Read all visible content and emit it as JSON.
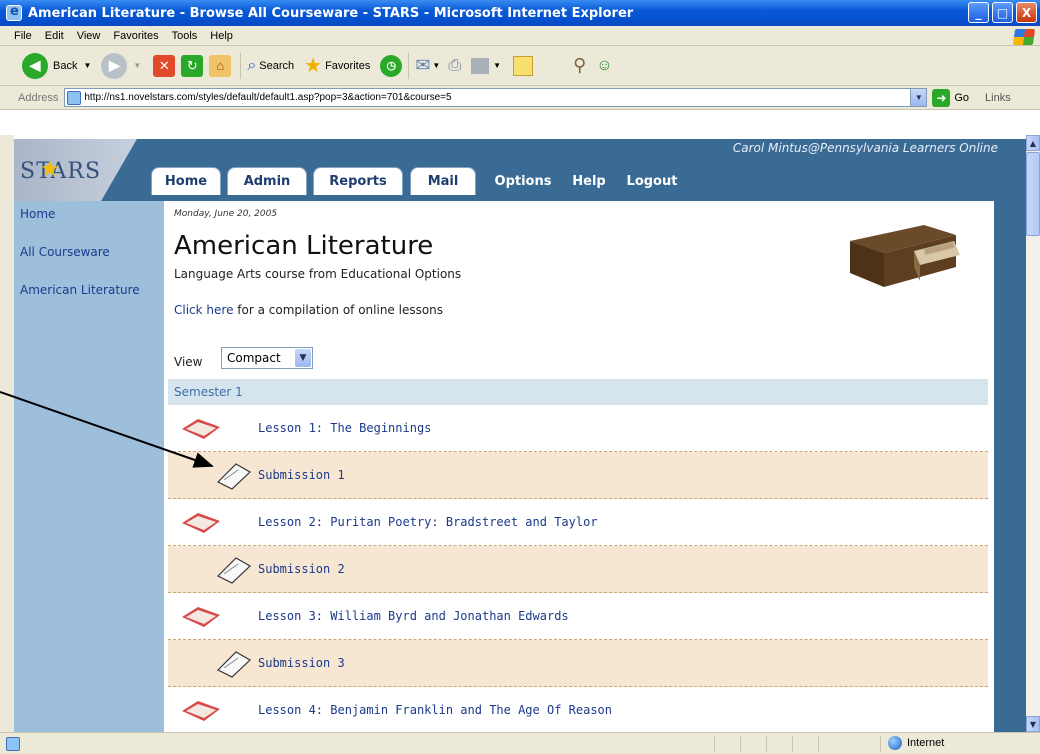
{
  "window": {
    "title": "American Literature - Browse All Courseware - STARS - Microsoft Internet Explorer",
    "minimize": "_",
    "maximize": "□",
    "close": "X"
  },
  "menu": [
    "File",
    "Edit",
    "View",
    "Favorites",
    "Tools",
    "Help"
  ],
  "toolbar": {
    "back_label": "Back",
    "search_label": "Search",
    "favorites_label": "Favorites"
  },
  "address": {
    "label": "Address",
    "url": "http://ns1.novelstars.com/styles/default/default1.asp?pop=3&action=701&course=5",
    "go_label": "Go",
    "links_label": "Links"
  },
  "site": {
    "logo": "STARS",
    "user": "Carol Mintus@Pennsylvania Learners Online",
    "tabs_light": [
      "Home",
      "Admin",
      "Reports",
      "Mail"
    ],
    "tabs_link": [
      "Options",
      "Help",
      "Logout"
    ]
  },
  "left_nav": [
    "Home",
    "All Courseware",
    "American Literature"
  ],
  "content": {
    "date": "Monday, June 20, 2005",
    "title": "American Literature",
    "subtitle": "Language Arts course from Educational Options",
    "click_here": "Click here",
    "compilation_rest": " for a compilation of online lessons",
    "view_label": "View",
    "view_selected": "Compact",
    "semester": "Semester 1",
    "rows": [
      {
        "type": "lesson",
        "label": "Lesson 1: The Beginnings"
      },
      {
        "type": "submission",
        "label": "Submission 1"
      },
      {
        "type": "lesson",
        "label": "Lesson 2: Puritan Poetry: Bradstreet and Taylor"
      },
      {
        "type": "submission",
        "label": "Submission 2"
      },
      {
        "type": "lesson",
        "label": "Lesson 3: William Byrd and Jonathan Edwards"
      },
      {
        "type": "submission",
        "label": "Submission 3"
      },
      {
        "type": "lesson",
        "label": "Lesson 4: Benjamin Franklin and The Age Of Reason"
      }
    ]
  },
  "status": {
    "zone": "Internet"
  },
  "colors": {
    "header_blue": "#3a6b94",
    "nav_blue": "#9dbfdc",
    "submission_bg": "#f7e6d2",
    "link_blue": "#1b3a8a"
  }
}
